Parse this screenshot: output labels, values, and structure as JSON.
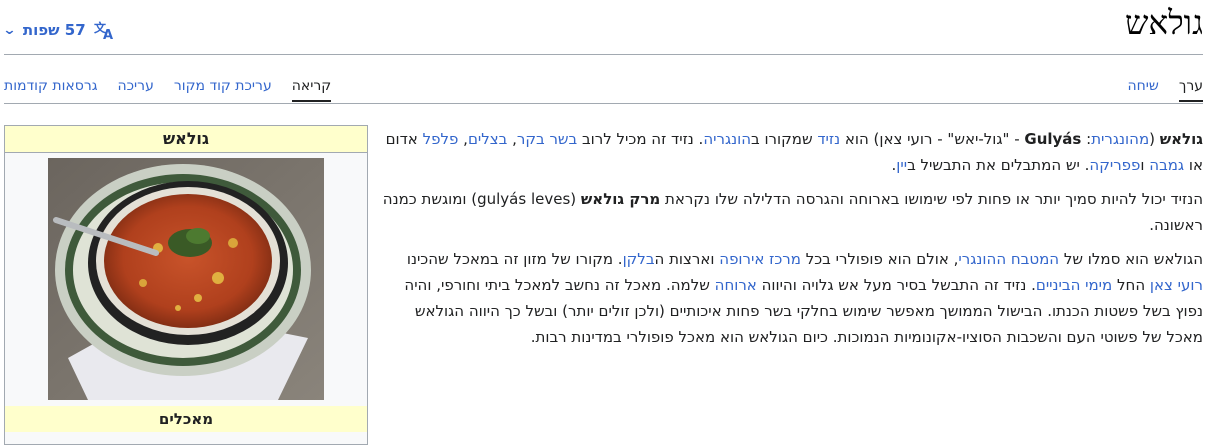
{
  "title": "גולאש",
  "languages": {
    "label": "57 שפות"
  },
  "tabs_right": [
    {
      "label": "ערך",
      "selected": true
    },
    {
      "label": "שיחה",
      "selected": false
    }
  ],
  "tabs_left": [
    {
      "label": "קריאה",
      "selected": true
    },
    {
      "label": "עריכת קוד מקור",
      "selected": false
    },
    {
      "label": "עריכה",
      "selected": false
    },
    {
      "label": "גרסאות קודמות",
      "selected": false
    }
  ],
  "infobox": {
    "title": "גולאש",
    "caption": "מאכלים"
  },
  "p1": {
    "t0": "גולאש",
    "t1": " (",
    "l0": "מהונגרית",
    "t2": ": ",
    "t3": "Gulyás",
    "t4": " - \"גול-יאש\" - רועי צאן) הוא ",
    "l1": "נזיד",
    "t5": " שמקורו ב",
    "l2": "הונגריה",
    "t6": ". נזיד זה מכיל לרוב ",
    "l3": "בשר בקר",
    "t7": ", ",
    "l4": "בצלים",
    "t8": ", ",
    "l5": "פלפל",
    "t9": " אדום או ",
    "l6": "גמבה",
    "t10": " ו",
    "l7": "פפריקה",
    "t11": ". יש המתבלים את התבשיל ב",
    "l8": "יין",
    "t12": "."
  },
  "p2": {
    "t0": "הנזיד יכול להיות סמיך יותר או פחות לפי שימושו בארוחה והגרסה הדלילה שלו נקראת ",
    "t1": "מרק גולאש",
    "t2": " (gulyás leves) ומוגשת כמנה ראשונה."
  },
  "p3": {
    "t0": "הגולאש הוא סמלו של ",
    "l0": "המטבח ההונגרי",
    "t1": ", אולם הוא פופולרי בכל ",
    "l1": "מרכז אירופה",
    "t2": " וארצות ה",
    "l2": "בלקן",
    "t3": ". מקורו של מזון זה במאכל שהכינו ",
    "l3": "רועי צאן",
    "t4": " החל ",
    "l4": "מימי הביניים",
    "t5": ". נזיד זה התבשל בסיר מעל אש גלויה והיווה ",
    "l5": "ארוחה",
    "t6": " שלמה. מאכל זה נחשב למאכל ביתי וחורפי, והיה נפוץ בשל פשטות הכנתו. הבישול הממושך מאפשר שימוש בחלקי בשר פחות איכותיים (ולכן זולים יותר) ובשל כך היווה הגולאש מאכל של פשוטי העם והשכבות הסוציו-אקונומיות הנמוכות. כיום הגולאש הוא מאכל פופולרי במדינות רבות."
  }
}
